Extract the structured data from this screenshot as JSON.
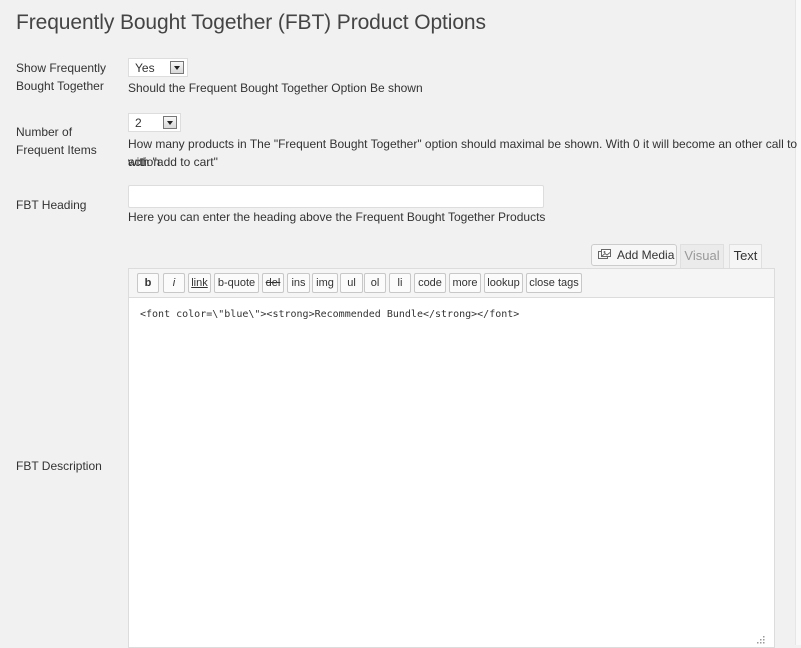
{
  "page": {
    "title": "Frequently Bought Together (FBT) Product Options"
  },
  "show_fbt": {
    "label": "Show Frequently Bought Together",
    "value": "Yes",
    "description": "Should the Frequent Bought Together Option Be shown"
  },
  "number_items": {
    "label": "Number of Frequent Items",
    "value": "2",
    "description_line1": "How many products in The \"Frequent Bought Together\" option should maximal be shown. With 0 it will become an other call to action",
    "description_line2": "with \"add to cart\""
  },
  "heading": {
    "label": "FBT Heading",
    "value": "",
    "description": "Here you can enter the heading above the Frequent Bought Together Products"
  },
  "description": {
    "label": "FBT Description",
    "add_media": "Add Media",
    "tabs": {
      "visual": "Visual",
      "text": "Text"
    },
    "quicktags": [
      "b",
      "i",
      "link",
      "b-quote",
      "del",
      "ins",
      "img",
      "ul",
      "ol",
      "li",
      "code",
      "more",
      "lookup",
      "close tags"
    ],
    "content": "<font color=\\\"blue\\\"><strong>Recommended Bundle</strong></font>"
  }
}
